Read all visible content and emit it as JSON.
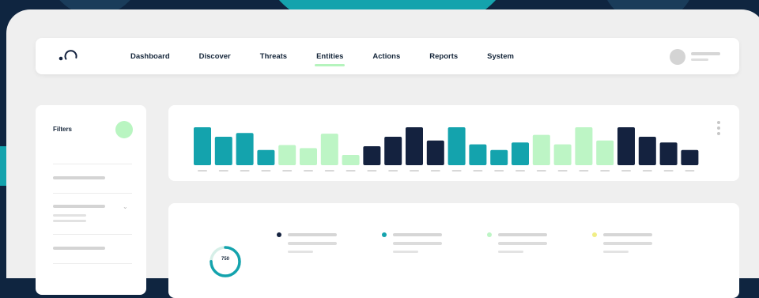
{
  "colors": {
    "background": "#0f2540",
    "teal": "#14a3ad",
    "navy": "#14223f",
    "mint": "#bdf5c5",
    "yellow": "#f0ee86"
  },
  "nav": {
    "logo_icon": "logo-mark",
    "items": [
      {
        "label": "Dashboard",
        "active": false
      },
      {
        "label": "Discover",
        "active": false
      },
      {
        "label": "Threats",
        "active": false
      },
      {
        "label": "Entities",
        "active": true
      },
      {
        "label": "Actions",
        "active": false
      },
      {
        "label": "Reports",
        "active": false
      },
      {
        "label": "System",
        "active": false
      }
    ],
    "user_avatar_icon": "avatar"
  },
  "filters": {
    "title": "Filters",
    "expand_icon": "chevron-down-icon"
  },
  "chart_data": {
    "type": "bar",
    "title": "",
    "xlabel": "",
    "ylabel": "",
    "ylim": [
      0,
      10
    ],
    "values": [
      10,
      7.5,
      8.5,
      4,
      5.3,
      4.5,
      8.3,
      2.7,
      5,
      7.5,
      10,
      6.5,
      10,
      5.5,
      4,
      6,
      8,
      5.5,
      10,
      6.5,
      10,
      7.5,
      6,
      4
    ],
    "bar_colors": [
      "teal",
      "teal",
      "teal",
      "teal",
      "mint",
      "mint",
      "mint",
      "mint",
      "navy",
      "navy",
      "navy",
      "navy",
      "teal",
      "teal",
      "teal",
      "teal",
      "mint",
      "mint",
      "mint",
      "mint",
      "navy",
      "navy",
      "navy",
      "navy"
    ],
    "menu_icon": "kebab-menu-icon"
  },
  "summary": {
    "donut_value": "750",
    "legend_colors": [
      "#14223f",
      "#14a3ad",
      "#bdf5c5",
      "#f0ee86"
    ]
  }
}
